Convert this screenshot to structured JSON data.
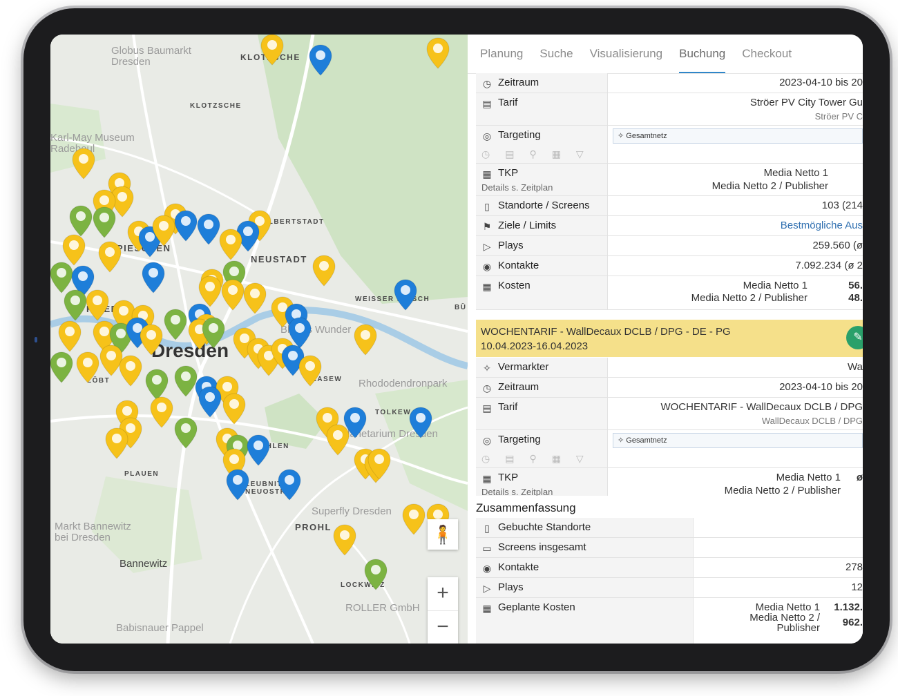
{
  "tabs": [
    "Planung",
    "Suche",
    "Visualisierung",
    "Buchung",
    "Checkout"
  ],
  "active_tab": "Buchung",
  "map": {
    "districts": [
      "KLOTZSCHE",
      "KLOTZSCHE",
      "ALBERTSTADT",
      "NEUSTADT",
      "WEISSER HIRSCH",
      "PIESCHEN",
      "FRIEDR",
      "BLASEW",
      "TOLKEW",
      "STREHLEN",
      "PLAUEN",
      "LEUBNITZ NEUOSTRA",
      "PROHL",
      "LOCKWITZ",
      "LÖBT",
      "BÜ"
    ],
    "city": "Dresden",
    "pois": [
      "Globus Baumarkt Dresden",
      "Karl-May Museum Radebeul",
      "Rhododendronpark",
      "Superfly Dresden",
      "Markt Bannewitz bei Dresden",
      "ROLLER GmbH",
      "Babisnauer Pappel",
      "Planetarium Dresden",
      "Blaues Wunder"
    ],
    "places": [
      "Bannewitz"
    ],
    "zoom_in": "+",
    "zoom_out": "−",
    "pegman": "pegman-icon"
  },
  "booking1": {
    "zeitraum_label": "Zeitraum",
    "zeitraum_value": "2023-04-10 bis 20",
    "tarif_label": "Tarif",
    "tarif_value": "Ströer PV City Tower Gu",
    "tarif_sub": "Ströer PV C",
    "targeting_label": "Targeting",
    "targeting_value": "Gesamtnetz",
    "tkp_label": "TKP",
    "tkp_sub": "Details s. Zeitplan",
    "tkp_value1": "Media Netto 1",
    "tkp_value2": "Media Netto 2 / Publisher",
    "standorte_label": "Standorte / Screens",
    "standorte_value": "103 (214",
    "ziele_label": "Ziele / Limits",
    "ziele_value": "Bestmögliche Aus",
    "plays_label": "Plays",
    "plays_value": "259.560 (ø",
    "kontakte_label": "Kontakte",
    "kontakte_value": "7.092.234 (ø 2",
    "kosten_label": "Kosten",
    "kosten_line1": "Media Netto 1",
    "kosten_amount1": "56.",
    "kosten_line2": "Media Netto 2 / Publisher",
    "kosten_amount2": "48."
  },
  "booking2": {
    "header_line1": "WOCHENTARIF - WallDecaux DCLB / DPG - DE - PG",
    "header_line2": "10.04.2023-16.04.2023",
    "vermarkter_label": "Vermarkter",
    "vermarkter_value": "Wa",
    "zeitraum_label": "Zeitraum",
    "zeitraum_value": "2023-04-10 bis 20",
    "tarif_label": "Tarif",
    "tarif_value": "WOCHENTARIF - WallDecaux DCLB / DPG",
    "tarif_sub": "WallDecaux DCLB / DPG",
    "targeting_label": "Targeting",
    "targeting_value": "Gesamtnetz",
    "tkp_label": "TKP",
    "tkp_sub": "Details s. Zeitplan",
    "tkp_value1": "Media Netto 1",
    "tkp_value1b": "ø",
    "tkp_value2": "Media Netto 2 / Publisher"
  },
  "summary": {
    "title": "Zusammenfassung",
    "standorte_label": "Gebuchte Standorte",
    "standorte_value": "",
    "screens_label": "Screens insgesamt",
    "screens_value": "",
    "kontakte_label": "Kontakte",
    "kontakte_value": "278",
    "plays_label": "Plays",
    "plays_value": "12",
    "kosten_label": "Geplante Kosten",
    "kosten_line1": "Media Netto 1",
    "kosten_amount1": "1.132.",
    "kosten_line2a": "Media Netto 2 /",
    "kosten_line2b": "Publisher",
    "kosten_amount2": "962."
  },
  "colors": {
    "accent": "#2f86c9",
    "marker_yellow": "#f6c21a",
    "marker_green": "#7cb342",
    "marker_blue": "#1e7ed9",
    "header_yellow": "#f5e08a"
  }
}
